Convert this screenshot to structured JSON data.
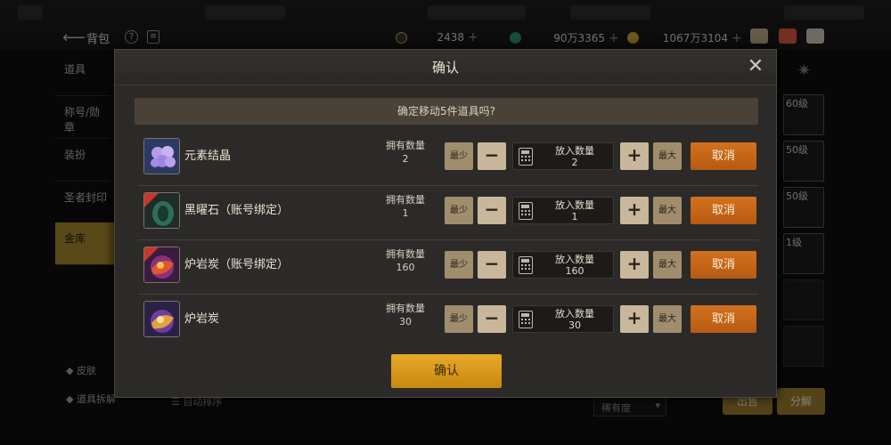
{
  "header": {
    "title": "背包",
    "currencies": [
      {
        "value": "2438",
        "icon": "c-coin-icon"
      },
      {
        "value": "90万3365",
        "icon": "green-gem-icon"
      },
      {
        "value": "1067万3104",
        "icon": "gold-coin-icon"
      }
    ]
  },
  "sidebar": {
    "items": [
      {
        "label": "道具"
      },
      {
        "label": "称号/勋章"
      },
      {
        "label": "装扮"
      },
      {
        "label": "圣者封印"
      },
      {
        "label": "金库"
      }
    ],
    "bottom": [
      {
        "label": "皮肤"
      },
      {
        "label": "道具拆解"
      }
    ]
  },
  "background": {
    "sort_label": "自动排序",
    "rarity_placeholder": "稀有度",
    "sell_label": "出售",
    "decompose_label": "分解",
    "slot_levels": [
      "60级",
      "50级",
      "50级",
      "1级"
    ]
  },
  "modal": {
    "title": "确认",
    "prompt": "确定移动5件道具吗?",
    "owned_label": "拥有数量",
    "put_label": "放入数量",
    "min_label": "最少",
    "max_label": "最大",
    "cancel_label": "取消",
    "confirm_label": "确认",
    "items": [
      {
        "name": "元素结晶",
        "owned": "2",
        "put": "2"
      },
      {
        "name": "黑曜石（账号绑定）",
        "owned": "1",
        "put": "1"
      },
      {
        "name": "炉岩炭（账号绑定）",
        "owned": "160",
        "put": "160"
      },
      {
        "name": "炉岩炭",
        "owned": "30",
        "put": "30"
      }
    ]
  }
}
